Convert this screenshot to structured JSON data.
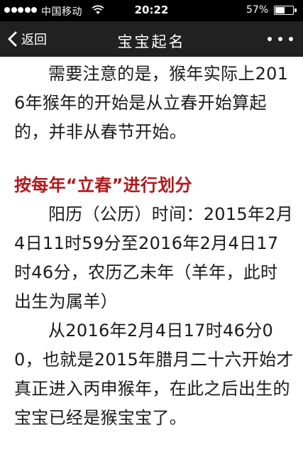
{
  "status_bar": {
    "signal_bars": 5,
    "carrier": "中国移动",
    "time": "20:22",
    "battery_percent_label": "57%",
    "battery_level": 0.57
  },
  "nav": {
    "back_label": "返回",
    "title": "宝宝起名"
  },
  "article": {
    "intro_paragraph": "需要注意的是，猴年实际上2016年猴年的开始是从立春开始算起的，并非从春节开始。",
    "section_heading": "按每年“立春”进行划分",
    "paragraph_1": "阳历（公历）时间：2015年2月4日11时59分至2016年2月4日17时46分，农历乙未年（羊年，此时出生为属羊）",
    "paragraph_2": "从2016年2月4日17时46分00，也就是2015年腊月二十六开始才真正进入丙申猴年，在此之后出生的宝宝已经是猴宝宝了。"
  },
  "colors": {
    "status_bar_bg": "#000000",
    "nav_bar_bg": "#212121",
    "heading_red": "#b0181c",
    "body_text": "#1a1a1a"
  },
  "icons": {
    "signal": "signal-dots-icon",
    "wifi": "wifi-icon",
    "battery": "battery-icon",
    "back": "chevron-left-icon",
    "more": "more-dots-icon"
  }
}
